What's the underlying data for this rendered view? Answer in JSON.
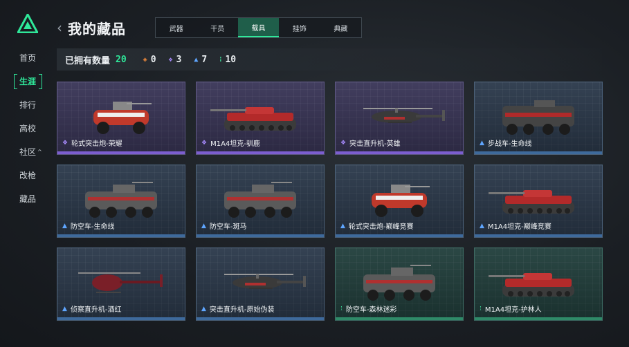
{
  "nav": {
    "items": [
      {
        "label": "首页"
      },
      {
        "label": "生涯"
      },
      {
        "label": "排行"
      },
      {
        "label": "高校"
      },
      {
        "label": "社区"
      },
      {
        "label": "改枪"
      },
      {
        "label": "藏品"
      }
    ],
    "active_index": 1
  },
  "header": {
    "title": "我的藏品"
  },
  "tabs": [
    {
      "label": "武器"
    },
    {
      "label": "干员"
    },
    {
      "label": "载具"
    },
    {
      "label": "挂饰"
    },
    {
      "label": "典藏"
    }
  ],
  "active_tab": 2,
  "stats": {
    "label": "已拥有数量",
    "total": "20",
    "legendary": "0",
    "epic": "3",
    "rare": "7",
    "uncommon": "10"
  },
  "colors": {
    "accent": "#2fe89a",
    "legendary": "#f08a3c",
    "epic": "#a98bff",
    "rare": "#5fa6ff",
    "uncommon": "#3fe6a0"
  },
  "items": [
    {
      "name": "轮式突击炮-荣耀",
      "rarity": "epic",
      "icon": "wheeled-assault-gun-icon"
    },
    {
      "name": "M1A4坦克-驯鹿",
      "rarity": "epic",
      "icon": "tank-icon"
    },
    {
      "name": "突击直升机-英雄",
      "rarity": "epic",
      "icon": "attack-helicopter-icon"
    },
    {
      "name": "步战车-生命线",
      "rarity": "rare",
      "icon": "ifv-icon"
    },
    {
      "name": "防空车-生命线",
      "rarity": "rare",
      "icon": "aa-vehicle-icon"
    },
    {
      "name": "防空车-斑马",
      "rarity": "rare",
      "icon": "aa-vehicle-icon"
    },
    {
      "name": "轮式突击炮-巅峰竞赛",
      "rarity": "rare",
      "icon": "wheeled-assault-gun-icon"
    },
    {
      "name": "M1A4坦克-巅峰竞赛",
      "rarity": "rare",
      "icon": "tank-icon"
    },
    {
      "name": "侦察直升机-酒红",
      "rarity": "rare",
      "icon": "scout-helicopter-icon"
    },
    {
      "name": "突击直升机-原始伪装",
      "rarity": "rare",
      "icon": "attack-helicopter-icon"
    },
    {
      "name": "防空车-森林迷彩",
      "rarity": "uncommon",
      "icon": "aa-vehicle-icon"
    },
    {
      "name": "M1A4坦克-护林人",
      "rarity": "uncommon",
      "icon": "tank-icon"
    }
  ]
}
